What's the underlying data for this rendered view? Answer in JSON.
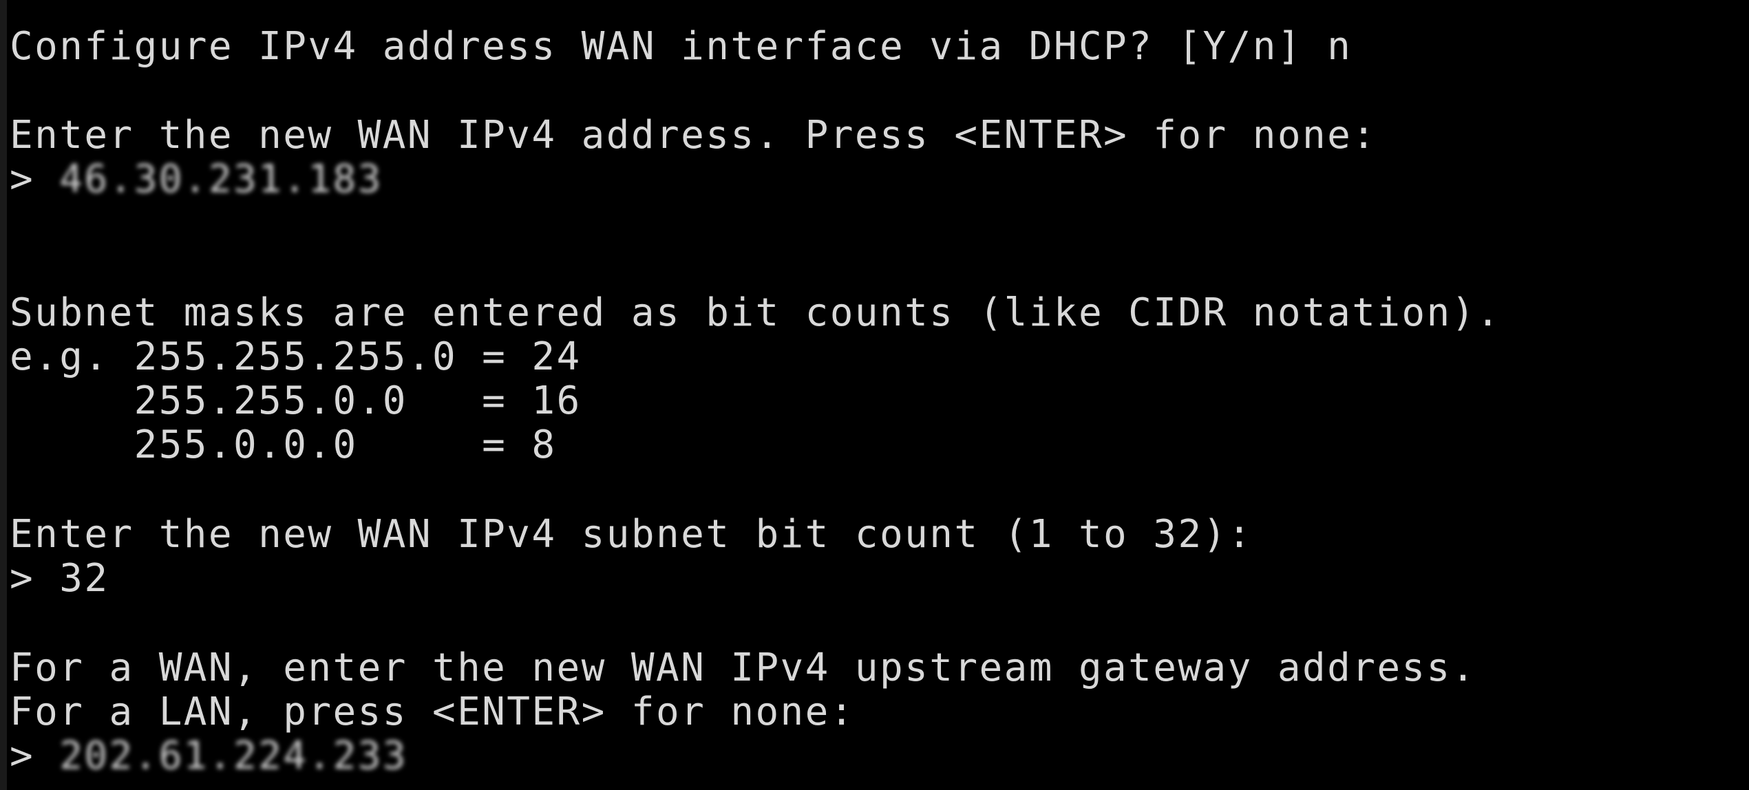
{
  "colors": {
    "background": "#000000",
    "text": "#d8d8d8",
    "left_edge": "#1a1a1a"
  },
  "terminal": {
    "dhcp_prompt": "Configure IPv4 address WAN interface via DHCP? [Y/n] n",
    "address_prompt": "Enter the new WAN IPv4 address. Press <ENTER> for none:",
    "address_input_prefix": "> ",
    "address_input_value": "46.30.231.183",
    "subnet_info_1": "Subnet masks are entered as bit counts (like CIDR notation).",
    "subnet_info_2": "e.g. 255.255.255.0 = 24",
    "subnet_info_3": "     255.255.0.0   = 16",
    "subnet_info_4": "     255.0.0.0     = 8",
    "subnet_prompt": "Enter the new WAN IPv4 subnet bit count (1 to 32):",
    "subnet_input": "> 32",
    "gateway_prompt_1": "For a WAN, enter the new WAN IPv4 upstream gateway address.",
    "gateway_prompt_2": "For a LAN, press <ENTER> for none:",
    "gateway_input_prefix": "> ",
    "gateway_input_value": "202.61.224.233"
  }
}
